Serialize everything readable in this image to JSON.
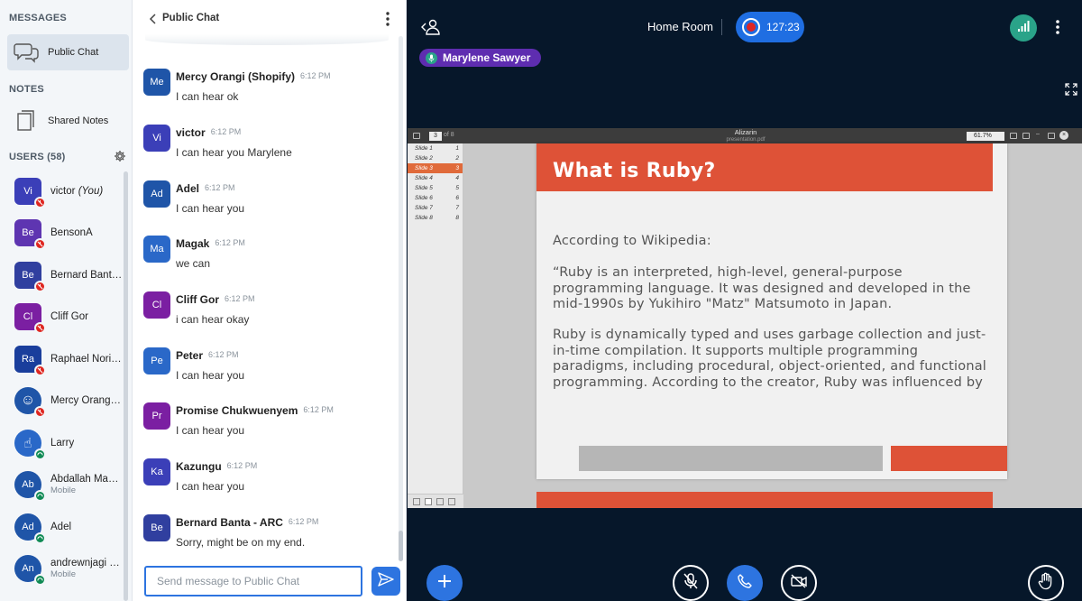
{
  "sidebar": {
    "messages_title": "MESSAGES",
    "public_chat_label": "Public Chat",
    "notes_title": "NOTES",
    "shared_notes_label": "Shared Notes",
    "users_title": "USERS (58)",
    "users": [
      {
        "initials": "Vi",
        "name": "victor",
        "you": "(You)",
        "sub": "",
        "color": "#3b3fb8",
        "badge": "red"
      },
      {
        "initials": "Be",
        "name": "BensonA",
        "you": "",
        "sub": "",
        "color": "#5e35b1",
        "badge": "red"
      },
      {
        "initials": "Be",
        "name": "Bernard Banta - ARC",
        "you": "",
        "sub": "",
        "color": "#303f9f",
        "badge": "red"
      },
      {
        "initials": "Cl",
        "name": "Cliff Gor",
        "you": "",
        "sub": "",
        "color": "#7b1fa2",
        "badge": "red"
      },
      {
        "initials": "Ra",
        "name": "Raphael Noriega",
        "you": "",
        "sub": "",
        "color": "#1a3e9c",
        "badge": "red"
      },
      {
        "initials": "☺",
        "name": "Mercy Orangi (Shopify)",
        "you": "",
        "sub": "",
        "color": "#1f55a8",
        "badge": "red"
      },
      {
        "initials": "☝",
        "name": "Larry",
        "you": "",
        "sub": "",
        "color": "#2a68c8",
        "badge": "green"
      },
      {
        "initials": "Ab",
        "name": "Abdallah Mahmoud",
        "you": "",
        "sub": "Mobile",
        "color": "#1f55a8",
        "badge": "green"
      },
      {
        "initials": "Ad",
        "name": "Adel",
        "you": "",
        "sub": "",
        "color": "#1f55a8",
        "badge": "green"
      },
      {
        "initials": "An",
        "name": "andrewnjagi Kamau",
        "you": "",
        "sub": "Mobile",
        "color": "#1f55a8",
        "badge": "green"
      }
    ]
  },
  "chat": {
    "title": "Public Chat",
    "input_placeholder": "Send message to Public Chat",
    "messages": [
      {
        "initials": "Me",
        "name": "Mercy Orangi (Shopify)",
        "time": "6:12 PM",
        "text": "I can hear ok",
        "color": "#1f55a8"
      },
      {
        "initials": "Vi",
        "name": "victor",
        "time": "6:12 PM",
        "text": "I can hear you Marylene",
        "color": "#3b3fb8"
      },
      {
        "initials": "Ad",
        "name": "Adel",
        "time": "6:12 PM",
        "text": "I can hear you",
        "color": "#1f55a8"
      },
      {
        "initials": "Ma",
        "name": "Magak",
        "time": "6:12 PM",
        "text": "we can",
        "color": "#2a68c8"
      },
      {
        "initials": "Cl",
        "name": "Cliff Gor",
        "time": "6:12 PM",
        "text": "i can hear okay",
        "color": "#7b1fa2"
      },
      {
        "initials": "Pe",
        "name": "Peter",
        "time": "6:12 PM",
        "text": "I can hear you",
        "color": "#2a68c8"
      },
      {
        "initials": "Pr",
        "name": "Promise Chukwuenyem",
        "time": "6:12 PM",
        "text": "I can hear you",
        "color": "#7b1fa2"
      },
      {
        "initials": "Ka",
        "name": "Kazungu",
        "time": "6:12 PM",
        "text": "I can hear you",
        "color": "#3b3fb8"
      },
      {
        "initials": "Be",
        "name": "Bernard Banta - ARC",
        "time": "6:12 PM",
        "text": "Sorry, might be on my end.",
        "color": "#303f9f"
      }
    ]
  },
  "main": {
    "room_name": "Home Room",
    "recording_time": "127:23",
    "talker_name": "Marylene Sawyer"
  },
  "presentation": {
    "viewer_title": "Alizarin",
    "viewer_file": "presentation.pdf",
    "page_current": "3",
    "page_of": "of 8",
    "zoom": "61.7%",
    "slides": [
      {
        "label": "Slide 1",
        "num": "1"
      },
      {
        "label": "Slide 2",
        "num": "2"
      },
      {
        "label": "Slide 3",
        "num": "3"
      },
      {
        "label": "Slide 4",
        "num": "4"
      },
      {
        "label": "Slide 5",
        "num": "5"
      },
      {
        "label": "Slide 6",
        "num": "6"
      },
      {
        "label": "Slide 7",
        "num": "7"
      },
      {
        "label": "Slide 8",
        "num": "8"
      }
    ],
    "active_slide": 3,
    "slide_title": "What is Ruby?",
    "slide_p1": "According to Wikipedia:",
    "slide_p2_l1": "“Ruby is an interpreted, high-level, general-purpose",
    "slide_p2_l2": "programming language. It was designed and developed in the",
    "slide_p2_l3": "mid-1990s by Yukihiro \"Matz\" Matsumoto in Japan.",
    "slide_p3_l1": "Ruby is dynamically typed and uses garbage collection and just-",
    "slide_p3_l2": "in-time compilation. It supports multiple programming",
    "slide_p3_l3": "paradigms, including procedural, object-oriented, and functional",
    "slide_p3_l4": "programming. According to the creator, Ruby was influenced by"
  },
  "colors": {
    "accent": "#2d74e0",
    "background": "#06172a",
    "slide_red": "#de5237",
    "talker": "#5e2db0",
    "connection": "#2aa389"
  },
  "icons": [
    "chat-bubbles-icon",
    "notes-icon",
    "gear-icon",
    "chevron-left-icon",
    "kebab-menu-icon",
    "send-icon",
    "users-toggle-icon",
    "record-icon",
    "signal-icon",
    "fullscreen-icon",
    "microphone-icon",
    "plus-icon",
    "mic-muted-icon",
    "phone-icon",
    "camera-off-icon",
    "raise-hand-icon"
  ]
}
